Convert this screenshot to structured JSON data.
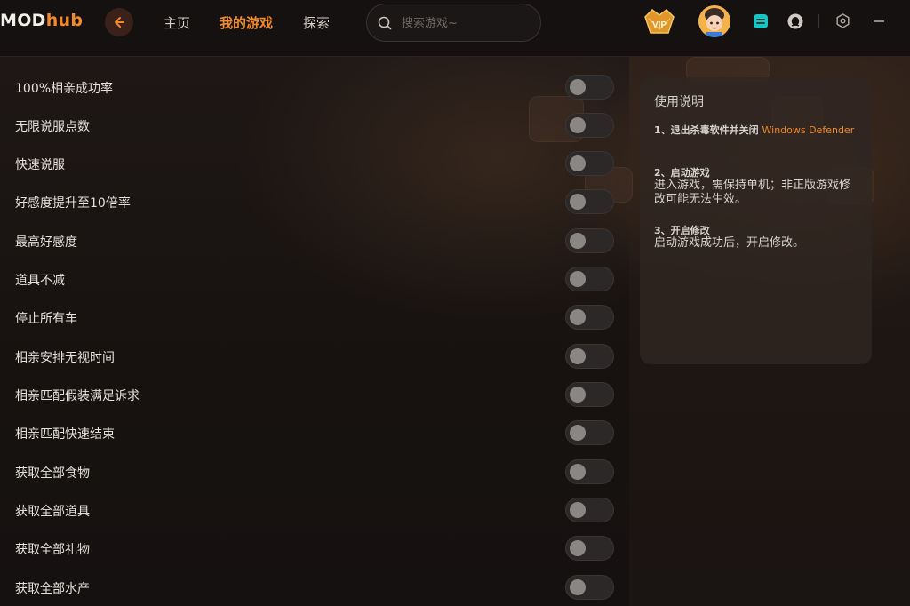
{
  "header": {
    "logo_main": "MOD",
    "logo_accent": "hub",
    "nav": [
      "主页",
      "我的游戏",
      "探索"
    ],
    "active_nav": "我的游戏",
    "search_placeholder": "搜索游戏~",
    "vip_label": "VIP"
  },
  "colors": {
    "accent": "#f08a2a",
    "toggle_off": "#2b2827",
    "teal_icon": "#17c6c4"
  },
  "mods": [
    {
      "label": "100%相亲成功率",
      "enabled": false
    },
    {
      "label": "无限说服点数",
      "enabled": false
    },
    {
      "label": "快速说服",
      "enabled": false
    },
    {
      "label": "好感度提升至10倍率",
      "enabled": false
    },
    {
      "label": "最高好感度",
      "enabled": false
    },
    {
      "label": "道具不减",
      "enabled": false
    },
    {
      "label": "停止所有车",
      "enabled": false
    },
    {
      "label": "相亲安排无视时间",
      "enabled": false
    },
    {
      "label": "相亲匹配假装满足诉求",
      "enabled": false
    },
    {
      "label": "相亲匹配快速结束",
      "enabled": false
    },
    {
      "label": "获取全部食物",
      "enabled": false
    },
    {
      "label": "获取全部道具",
      "enabled": false
    },
    {
      "label": "获取全部礼物",
      "enabled": false
    },
    {
      "label": "获取全部水产",
      "enabled": false
    }
  ],
  "instructions": {
    "title": "使用说明",
    "step1_title": "1、退出杀毒软件并关闭",
    "step1_highlight": "Windows Defender",
    "step2_title": "2、启动游戏",
    "step2_desc": "进入游戏，需保持单机；非正版游戏修改可能无法生效。",
    "step3_title": "3、开启修改",
    "step3_desc": "启动游戏成功后，开启修改。"
  }
}
